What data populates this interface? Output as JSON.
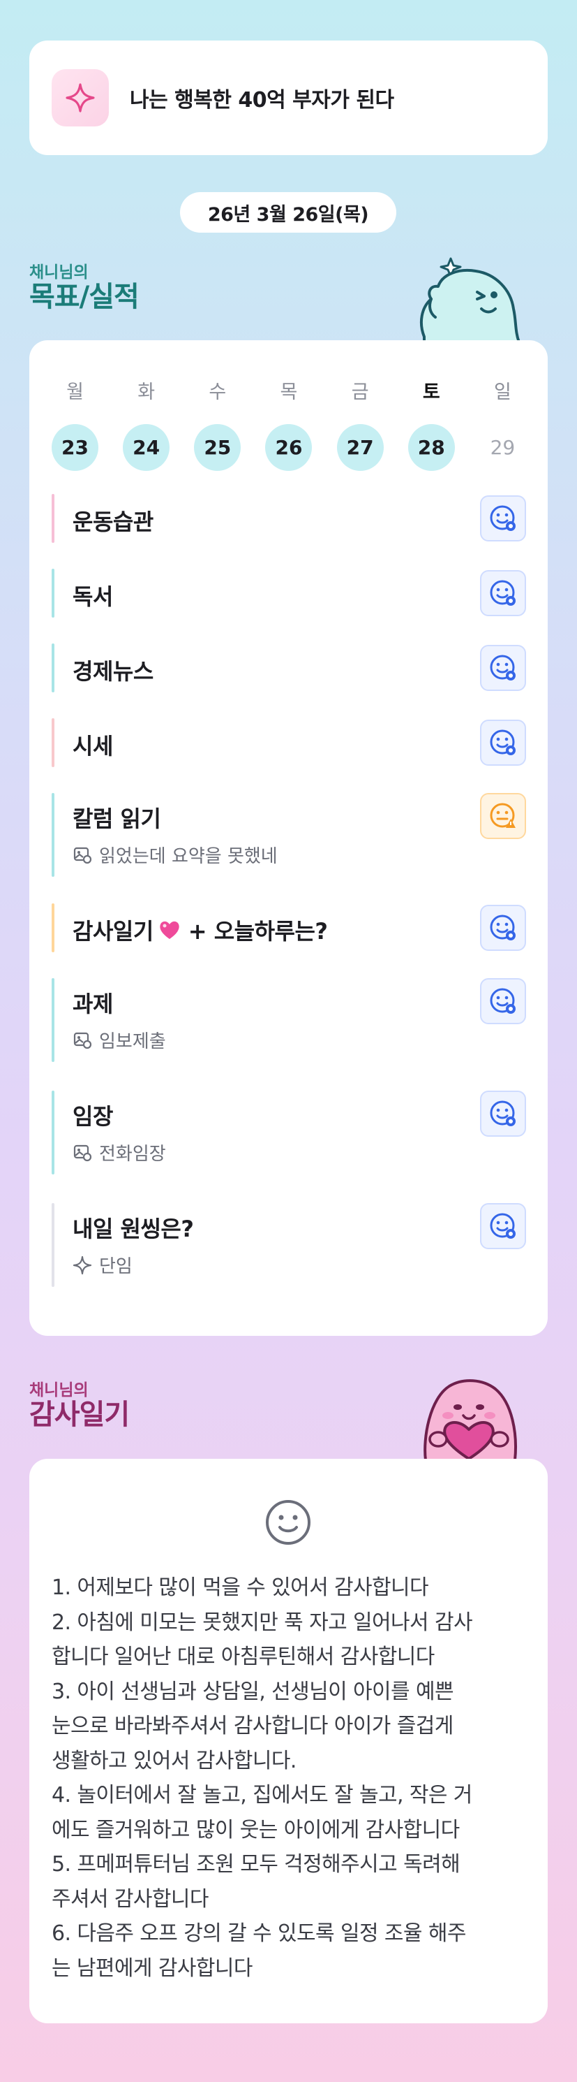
{
  "goal": {
    "text": "나는 행복한 40억 부자가 된다",
    "icon": "sparkle-icon"
  },
  "date": "26년 3월 26일(목)",
  "goals_section": {
    "subtitle": "채니님의",
    "title": "목표/실적"
  },
  "week": [
    {
      "label": "월",
      "num": "23",
      "marked": true
    },
    {
      "label": "화",
      "num": "24",
      "marked": true
    },
    {
      "label": "수",
      "num": "25",
      "marked": true
    },
    {
      "label": "목",
      "num": "26",
      "marked": true
    },
    {
      "label": "금",
      "num": "27",
      "marked": true
    },
    {
      "label": "토",
      "num": "28",
      "marked": true,
      "current": true
    },
    {
      "label": "일",
      "num": "29",
      "marked": false
    }
  ],
  "items": [
    {
      "title": "운동습관",
      "bar_color": "#f6bfd6",
      "status": "smile"
    },
    {
      "title": "독서",
      "bar_color": "#a8e4e6",
      "status": "smile"
    },
    {
      "title": "경제뉴스",
      "bar_color": "#a8e4e6",
      "status": "smile"
    },
    {
      "title": "시세",
      "bar_color": "#f8c9cc",
      "status": "smile"
    },
    {
      "title": "칼럼 읽기",
      "note": "읽었는데 요약을 못했네",
      "note_icon": "photo-icon",
      "bar_color": "#a8e4e6",
      "status": "warning"
    },
    {
      "title": "감사일기",
      "title_suffix": "+ 오늘하루는?",
      "heart": "heart-icon",
      "bar_color": "#ffd69a",
      "status": "smile"
    },
    {
      "title": "과제",
      "note": "임보제출",
      "note_icon": "photo-icon",
      "bar_color": "#a8e4e6",
      "status": "smile"
    },
    {
      "title": "임장",
      "note": "전화임장",
      "note_icon": "photo-icon",
      "bar_color": "#a8e4e6",
      "status": "smile"
    },
    {
      "title": "내일 원씽은?",
      "note": "단임",
      "note_icon": "sparkle-icon",
      "bar_color": "#e2e2ea",
      "status": "smile"
    }
  ],
  "gratitude_section": {
    "subtitle": "채니님의",
    "title": "감사일기"
  },
  "gratitude": {
    "mood_icon": "smile-face-icon",
    "lines": [
      "1. 어제보다 많이 먹을 수 있어서 감사합니다",
      "2. 아침에 미모는 못했지만 푹 자고 일어나서 감사",
      "합니다 일어난 대로 아침루틴해서 감사합니다",
      "3. 아이 선생님과 상담일, 선생님이 아이를 예쁜",
      "눈으로 바라봐주셔서 감사합니다 아이가 즐겁게",
      "생활하고 있어서 감사합니다.",
      "4. 놀이터에서 잘 놀고, 집에서도 잘 놀고, 작은 거",
      "에도 즐거워하고 많이 웃는 아이에게 감사합니다",
      "5. 프메퍼튜터님 조원 모두 걱정해주시고 독려해",
      "주셔서 감사합니다",
      "6. 다음주 오프 강의 갈 수 있도록 일정 조율 해주",
      "는 남편에게 감사합니다"
    ]
  },
  "colors": {
    "accent_blue": "#3566e8",
    "warning_orange": "#f59a23",
    "day_circle": "#c6eff3"
  }
}
